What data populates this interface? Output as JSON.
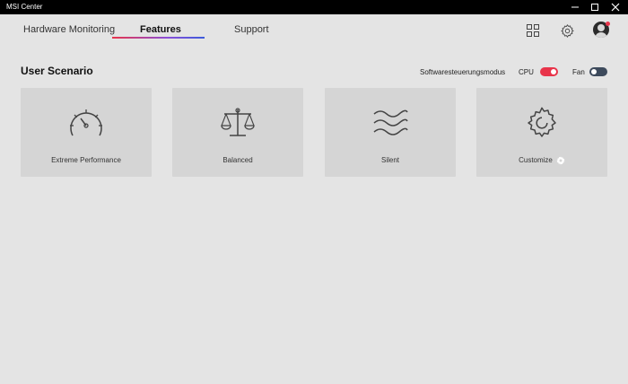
{
  "window": {
    "title": "MSI Center"
  },
  "nav": {
    "tabs": [
      {
        "label": "Hardware Monitoring",
        "active": false
      },
      {
        "label": "Features",
        "active": true
      },
      {
        "label": "Support",
        "active": false
      }
    ]
  },
  "header_icons": [
    "grid-icon",
    "gear-icon",
    "avatar"
  ],
  "section": {
    "title": "User Scenario",
    "mode_label": "Softwaresteuerungsmodus",
    "cpu_label": "CPU",
    "cpu_toggle_on": true,
    "fan_label": "Fan",
    "fan_toggle_on": false
  },
  "scenarios": [
    {
      "label": "Extreme Performance",
      "icon": "speedometer-icon"
    },
    {
      "label": "Balanced",
      "icon": "scale-icon"
    },
    {
      "label": "Silent",
      "icon": "wave-icon"
    },
    {
      "label": "Customize",
      "icon": "gear-icon"
    }
  ],
  "colors": {
    "background": "#e4e4e4",
    "card": "#d5d5d5",
    "accent_red": "#e8344a",
    "accent_blue": "#3b5bdb",
    "toggle_off": "#3d4a5c"
  }
}
